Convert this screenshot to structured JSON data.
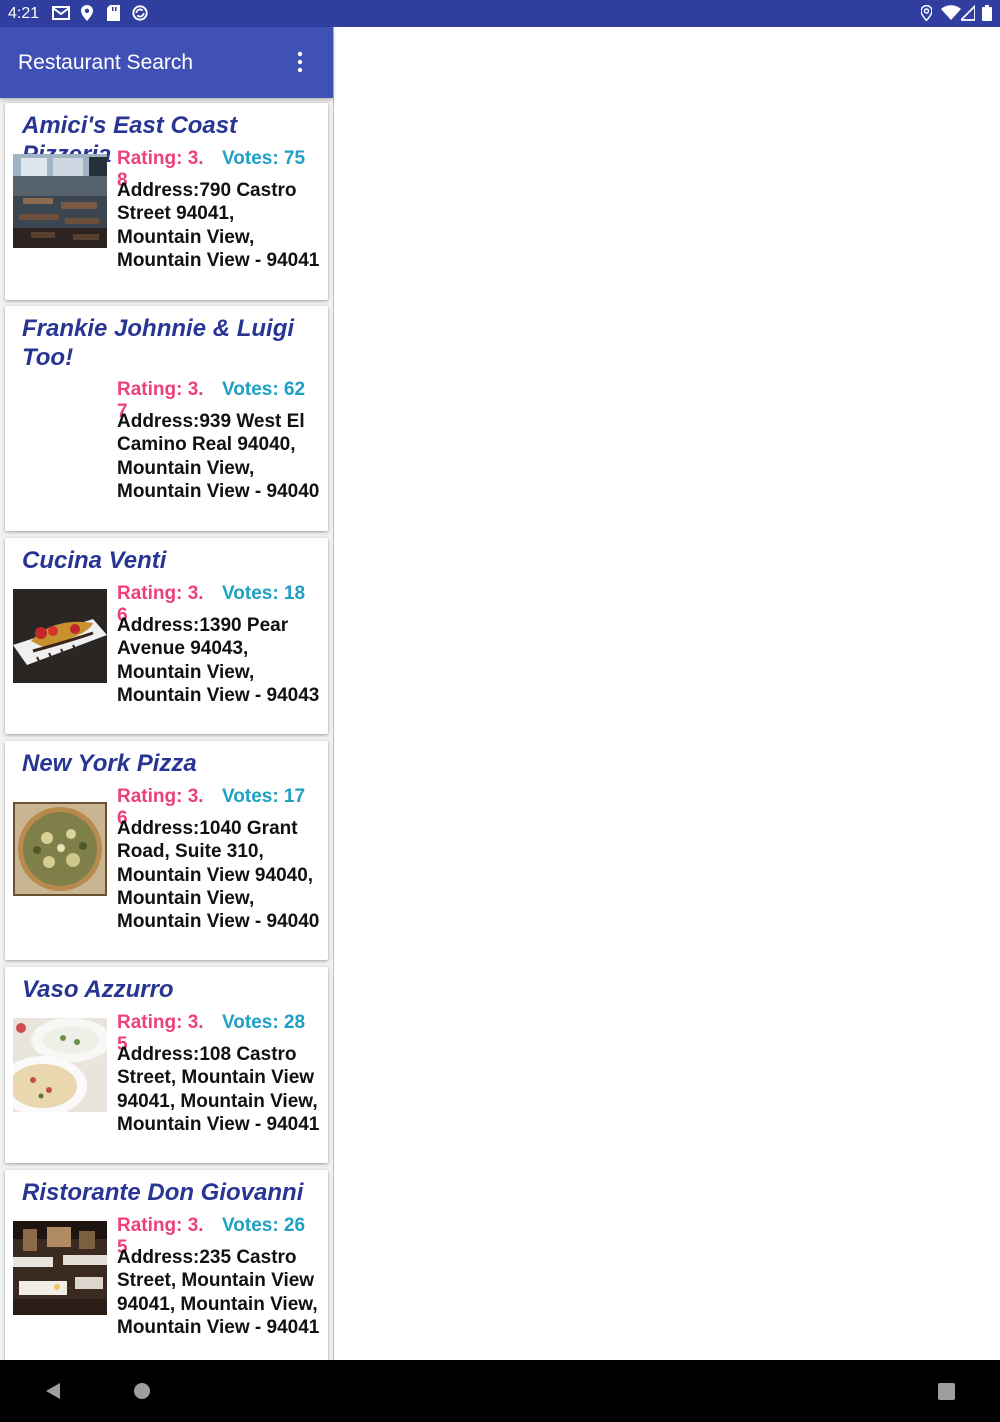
{
  "status_bar": {
    "time": "4:21",
    "left_icons": [
      "gmail-icon",
      "location-icon",
      "sd-card-icon",
      "sync-icon"
    ],
    "right_icons": [
      "location-icon",
      "wifi-icon",
      "signal-icon",
      "battery-icon"
    ]
  },
  "app_bar": {
    "title": "Restaurant Search",
    "menu_icon": "overflow-menu-icon",
    "color": "#3f51b5"
  },
  "colors": {
    "status_bar": "#303f9f",
    "name": "#283593",
    "rating": "#ec407a",
    "votes": "#1e9fc4"
  },
  "restaurants": [
    {
      "name": "Amici's East Coast Pizzeria",
      "rating": "Rating: 3.8",
      "votes": "Votes: 75",
      "address": "Address:790 Castro Street 94041, Mountain View, Mountain View - 94041",
      "image": "restaurant-interior-image"
    },
    {
      "name": "Frankie Johnnie & Luigi Too!",
      "rating": "Rating: 3.7",
      "votes": "Votes: 62",
      "address": "Address:939 West El Camino Real 94040, Mountain View, Mountain View - 94040",
      "image": ""
    },
    {
      "name": "Cucina Venti",
      "rating": "Rating: 3.6",
      "votes": "Votes: 18",
      "address": "Address:1390 Pear Avenue 94043, Mountain View, Mountain View - 94043",
      "image": "dessert-plate-image"
    },
    {
      "name": "New York Pizza",
      "rating": "Rating: 3.6",
      "votes": "Votes: 17",
      "address": "Address:1040 Grant Road, Suite 310, Mountain View 94040, Mountain View, Mountain View - 94040",
      "image": "pizza-image"
    },
    {
      "name": "Vaso Azzurro",
      "rating": "Rating: 3.5",
      "votes": "Votes: 28",
      "address": "Address:108 Castro Street, Mountain View 94041, Mountain View, Mountain View - 94041",
      "image": "pasta-plates-image"
    },
    {
      "name": "Ristorante Don Giovanni",
      "rating": "Rating: 3.5",
      "votes": "Votes: 26",
      "address": "Address:235 Castro Street, Mountain View 94041, Mountain View, Mountain View - 94041",
      "image": "dining-room-image"
    }
  ],
  "nav_bar": {
    "icons": [
      "back-icon",
      "home-icon",
      "recents-icon"
    ]
  }
}
